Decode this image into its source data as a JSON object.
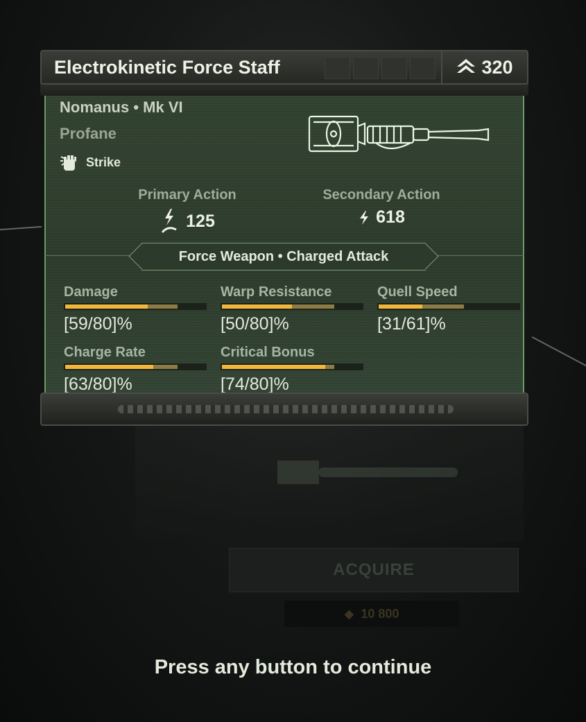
{
  "weapon": {
    "title": "Electrokinetic Force Staff",
    "rating": "320",
    "name": "Nomanus • Mk VI",
    "rarity": "Profane",
    "attack_type": "Strike"
  },
  "actions": {
    "primary": {
      "label": "Primary Action",
      "value": "125"
    },
    "secondary": {
      "label": "Secondary Action",
      "value": "618"
    }
  },
  "keywords": "Force Weapon • Charged Attack",
  "stats": [
    {
      "label": "Damage",
      "value": "[59/80]%",
      "current": 59,
      "max": 80
    },
    {
      "label": "Warp Resistance",
      "value": "[50/80]%",
      "current": 50,
      "max": 80
    },
    {
      "label": "Quell Speed",
      "value": "[31/61]%",
      "current": 31,
      "max": 61
    },
    {
      "label": "Charge Rate",
      "value": "[63/80]%",
      "current": 63,
      "max": 80
    },
    {
      "label": "Critical Bonus",
      "value": "[74/80]%",
      "current": 74,
      "max": 80
    }
  ],
  "background": {
    "acquire_label": "ACQUIRE",
    "cost": "10 800"
  },
  "prompt": "Press any button to continue",
  "colors": {
    "accent_gold": "#f2b63c",
    "panel_green": "#2c3a2b",
    "border_green": "#6e9a68"
  }
}
